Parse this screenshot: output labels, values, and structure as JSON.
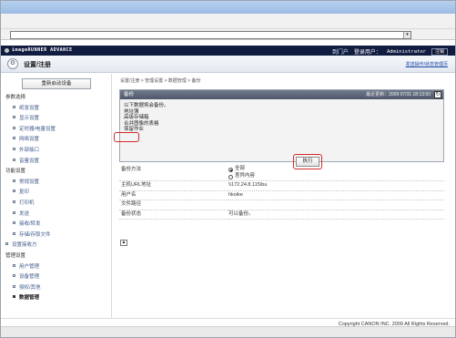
{
  "browser": {
    "address_value": ""
  },
  "brand": {
    "name": "imageRUNNER ADVANCE",
    "portal_label": "到门户",
    "login_user_label": "登录用户：",
    "user_name": "Administrator",
    "logout_label": "注销"
  },
  "header": {
    "title": "设置/注册",
    "link_label": "发送操作/状态管理页"
  },
  "sidebar": {
    "reboot_label": "重新启动设备",
    "nav": [
      {
        "type": "group",
        "label": "参数选择"
      },
      {
        "type": "item",
        "label": "纸张设置"
      },
      {
        "type": "item",
        "label": "显示设置"
      },
      {
        "type": "item",
        "label": "定时器/电量设置"
      },
      {
        "type": "item",
        "label": "网络设置"
      },
      {
        "type": "item",
        "label": "外部接口"
      },
      {
        "type": "item",
        "label": "音量设置"
      },
      {
        "type": "group",
        "label": "功能设置"
      },
      {
        "type": "item",
        "label": "常规设置"
      },
      {
        "type": "item",
        "label": "复印"
      },
      {
        "type": "item",
        "label": "打印机"
      },
      {
        "type": "item",
        "label": "发送"
      },
      {
        "type": "item",
        "label": "接收/转发"
      },
      {
        "type": "item",
        "label": "存储/存取文件"
      },
      {
        "type": "top",
        "label": "设置接收方"
      },
      {
        "type": "group",
        "label": "管理设置"
      },
      {
        "type": "item",
        "label": "用户管理"
      },
      {
        "type": "item",
        "label": "设备管理"
      },
      {
        "type": "item",
        "label": "授权/其他"
      },
      {
        "type": "active",
        "label": "数据管理"
      }
    ]
  },
  "content": {
    "breadcrumb": "设置/注册 > 管理设置 > 数据管理 > 备份",
    "panel": {
      "title": "备份",
      "updated": "最近更新：2009 07/31 18:13:50",
      "intro": "以下数据将会备份。",
      "items": [
        "地址簿",
        "高级存储箱",
        "合并图像的表格",
        "保留作业"
      ],
      "execute_label": "执行"
    },
    "table": {
      "method_label": "备份方法",
      "method_all": "全部",
      "method_diff": "差异内容",
      "host_label": "主机URL地址",
      "host_value": "\\\\172.24.8.115\\bu",
      "user_label": "用户名",
      "user_value": "hkoike",
      "path_label": "文件路径",
      "path_value": "",
      "status_label": "备份状态",
      "status_value": "可以备份。"
    }
  },
  "footer": {
    "copyright": "Copyright CANON INC. 2009 All Rights Reserved."
  }
}
